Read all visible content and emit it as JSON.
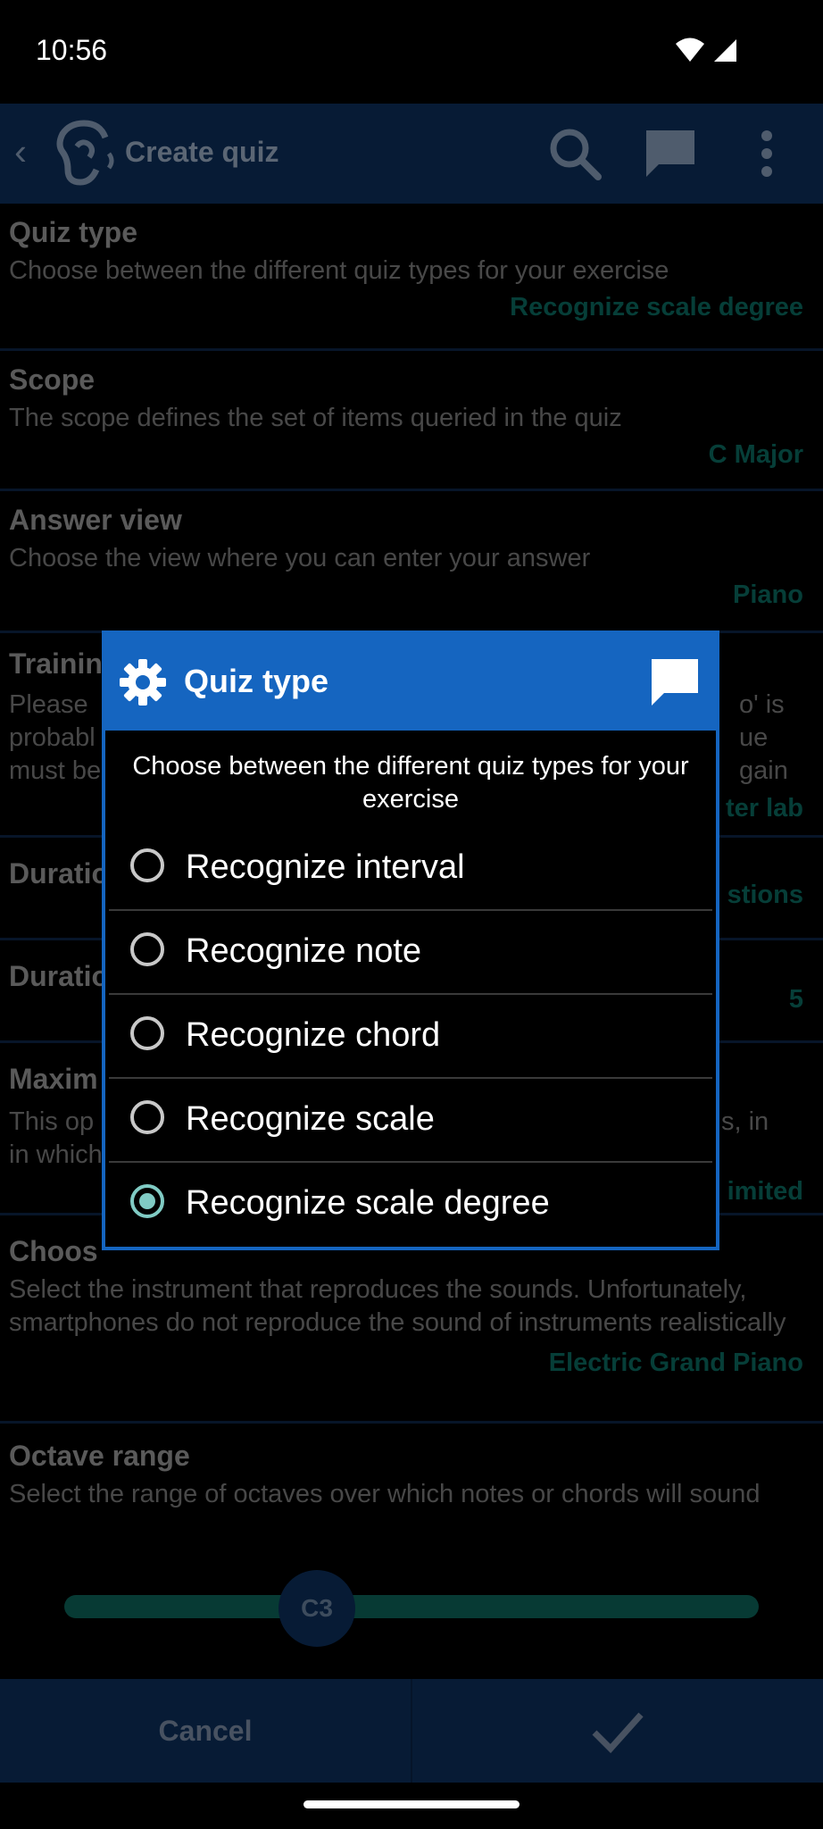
{
  "status": {
    "time": "10:56"
  },
  "appbar": {
    "title": "Create quiz",
    "icons": [
      "back-icon",
      "ear-logo-icon",
      "search-icon",
      "chat-icon",
      "more-icon"
    ]
  },
  "prefs": [
    {
      "title": "Quiz type",
      "subtitle": "Choose between the different quiz types for your exercise",
      "value": "Recognize scale degree"
    },
    {
      "title": "Scope",
      "subtitle": "The scope defines the set of items queried in the quiz",
      "value": "C Major"
    },
    {
      "title": "Answer view",
      "subtitle": "Choose the view where you can enter your answer",
      "value": "Piano"
    },
    {
      "title": "Trainin",
      "subtitle_left": "Please\nprobabl\nmust be",
      "subtitle_right": "o' is\nue\ngain",
      "value": "ter lab"
    },
    {
      "title": "Duratio",
      "value": "stions"
    },
    {
      "title": "Duratio",
      "value": "5"
    },
    {
      "title": "Maxim",
      "subtitle_left": "This op\nin which y",
      "subtitle_right": "s, in",
      "value": "imited"
    },
    {
      "title": "Choos",
      "subtitle": "Select the instrument that reproduces the sounds. Unfortunately, smartphones do not reproduce the sound of instruments realistically",
      "value": "Electric Grand Piano"
    },
    {
      "title": "Octave range",
      "subtitle": "Select the range of octaves over which notes or chords will sound"
    }
  ],
  "slider": {
    "thumb_label": "C3"
  },
  "bottom": {
    "cancel": "Cancel"
  },
  "dialog": {
    "title": "Quiz type",
    "description": "Choose between the different quiz types for your exercise",
    "options": [
      {
        "label": "Recognize interval",
        "selected": false
      },
      {
        "label": "Recognize note",
        "selected": false
      },
      {
        "label": "Recognize chord",
        "selected": false
      },
      {
        "label": "Recognize scale",
        "selected": false
      },
      {
        "label": "Recognize scale degree",
        "selected": true
      }
    ]
  },
  "colors": {
    "appbar": "#0b2a52",
    "dialog_header": "#1565c0",
    "accent": "#80cbc4",
    "value_text": "#0a6056"
  }
}
